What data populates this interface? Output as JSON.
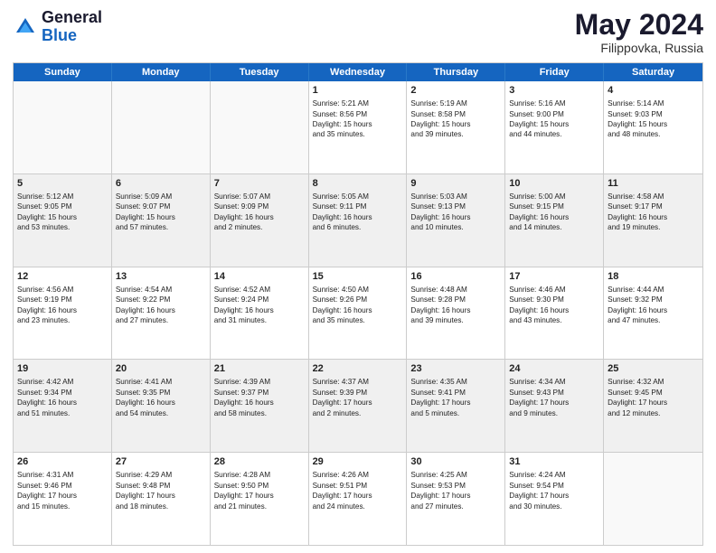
{
  "header": {
    "logo_general": "General",
    "logo_blue": "Blue",
    "month_year": "May 2024",
    "location": "Filippovka, Russia"
  },
  "days_of_week": [
    "Sunday",
    "Monday",
    "Tuesday",
    "Wednesday",
    "Thursday",
    "Friday",
    "Saturday"
  ],
  "weeks": [
    [
      {
        "day": "",
        "lines": []
      },
      {
        "day": "",
        "lines": []
      },
      {
        "day": "",
        "lines": []
      },
      {
        "day": "1",
        "lines": [
          "Sunrise: 5:21 AM",
          "Sunset: 8:56 PM",
          "Daylight: 15 hours",
          "and 35 minutes."
        ]
      },
      {
        "day": "2",
        "lines": [
          "Sunrise: 5:19 AM",
          "Sunset: 8:58 PM",
          "Daylight: 15 hours",
          "and 39 minutes."
        ]
      },
      {
        "day": "3",
        "lines": [
          "Sunrise: 5:16 AM",
          "Sunset: 9:00 PM",
          "Daylight: 15 hours",
          "and 44 minutes."
        ]
      },
      {
        "day": "4",
        "lines": [
          "Sunrise: 5:14 AM",
          "Sunset: 9:03 PM",
          "Daylight: 15 hours",
          "and 48 minutes."
        ]
      }
    ],
    [
      {
        "day": "5",
        "lines": [
          "Sunrise: 5:12 AM",
          "Sunset: 9:05 PM",
          "Daylight: 15 hours",
          "and 53 minutes."
        ]
      },
      {
        "day": "6",
        "lines": [
          "Sunrise: 5:09 AM",
          "Sunset: 9:07 PM",
          "Daylight: 15 hours",
          "and 57 minutes."
        ]
      },
      {
        "day": "7",
        "lines": [
          "Sunrise: 5:07 AM",
          "Sunset: 9:09 PM",
          "Daylight: 16 hours",
          "and 2 minutes."
        ]
      },
      {
        "day": "8",
        "lines": [
          "Sunrise: 5:05 AM",
          "Sunset: 9:11 PM",
          "Daylight: 16 hours",
          "and 6 minutes."
        ]
      },
      {
        "day": "9",
        "lines": [
          "Sunrise: 5:03 AM",
          "Sunset: 9:13 PM",
          "Daylight: 16 hours",
          "and 10 minutes."
        ]
      },
      {
        "day": "10",
        "lines": [
          "Sunrise: 5:00 AM",
          "Sunset: 9:15 PM",
          "Daylight: 16 hours",
          "and 14 minutes."
        ]
      },
      {
        "day": "11",
        "lines": [
          "Sunrise: 4:58 AM",
          "Sunset: 9:17 PM",
          "Daylight: 16 hours",
          "and 19 minutes."
        ]
      }
    ],
    [
      {
        "day": "12",
        "lines": [
          "Sunrise: 4:56 AM",
          "Sunset: 9:19 PM",
          "Daylight: 16 hours",
          "and 23 minutes."
        ]
      },
      {
        "day": "13",
        "lines": [
          "Sunrise: 4:54 AM",
          "Sunset: 9:22 PM",
          "Daylight: 16 hours",
          "and 27 minutes."
        ]
      },
      {
        "day": "14",
        "lines": [
          "Sunrise: 4:52 AM",
          "Sunset: 9:24 PM",
          "Daylight: 16 hours",
          "and 31 minutes."
        ]
      },
      {
        "day": "15",
        "lines": [
          "Sunrise: 4:50 AM",
          "Sunset: 9:26 PM",
          "Daylight: 16 hours",
          "and 35 minutes."
        ]
      },
      {
        "day": "16",
        "lines": [
          "Sunrise: 4:48 AM",
          "Sunset: 9:28 PM",
          "Daylight: 16 hours",
          "and 39 minutes."
        ]
      },
      {
        "day": "17",
        "lines": [
          "Sunrise: 4:46 AM",
          "Sunset: 9:30 PM",
          "Daylight: 16 hours",
          "and 43 minutes."
        ]
      },
      {
        "day": "18",
        "lines": [
          "Sunrise: 4:44 AM",
          "Sunset: 9:32 PM",
          "Daylight: 16 hours",
          "and 47 minutes."
        ]
      }
    ],
    [
      {
        "day": "19",
        "lines": [
          "Sunrise: 4:42 AM",
          "Sunset: 9:34 PM",
          "Daylight: 16 hours",
          "and 51 minutes."
        ]
      },
      {
        "day": "20",
        "lines": [
          "Sunrise: 4:41 AM",
          "Sunset: 9:35 PM",
          "Daylight: 16 hours",
          "and 54 minutes."
        ]
      },
      {
        "day": "21",
        "lines": [
          "Sunrise: 4:39 AM",
          "Sunset: 9:37 PM",
          "Daylight: 16 hours",
          "and 58 minutes."
        ]
      },
      {
        "day": "22",
        "lines": [
          "Sunrise: 4:37 AM",
          "Sunset: 9:39 PM",
          "Daylight: 17 hours",
          "and 2 minutes."
        ]
      },
      {
        "day": "23",
        "lines": [
          "Sunrise: 4:35 AM",
          "Sunset: 9:41 PM",
          "Daylight: 17 hours",
          "and 5 minutes."
        ]
      },
      {
        "day": "24",
        "lines": [
          "Sunrise: 4:34 AM",
          "Sunset: 9:43 PM",
          "Daylight: 17 hours",
          "and 9 minutes."
        ]
      },
      {
        "day": "25",
        "lines": [
          "Sunrise: 4:32 AM",
          "Sunset: 9:45 PM",
          "Daylight: 17 hours",
          "and 12 minutes."
        ]
      }
    ],
    [
      {
        "day": "26",
        "lines": [
          "Sunrise: 4:31 AM",
          "Sunset: 9:46 PM",
          "Daylight: 17 hours",
          "and 15 minutes."
        ]
      },
      {
        "day": "27",
        "lines": [
          "Sunrise: 4:29 AM",
          "Sunset: 9:48 PM",
          "Daylight: 17 hours",
          "and 18 minutes."
        ]
      },
      {
        "day": "28",
        "lines": [
          "Sunrise: 4:28 AM",
          "Sunset: 9:50 PM",
          "Daylight: 17 hours",
          "and 21 minutes."
        ]
      },
      {
        "day": "29",
        "lines": [
          "Sunrise: 4:26 AM",
          "Sunset: 9:51 PM",
          "Daylight: 17 hours",
          "and 24 minutes."
        ]
      },
      {
        "day": "30",
        "lines": [
          "Sunrise: 4:25 AM",
          "Sunset: 9:53 PM",
          "Daylight: 17 hours",
          "and 27 minutes."
        ]
      },
      {
        "day": "31",
        "lines": [
          "Sunrise: 4:24 AM",
          "Sunset: 9:54 PM",
          "Daylight: 17 hours",
          "and 30 minutes."
        ]
      },
      {
        "day": "",
        "lines": []
      }
    ]
  ]
}
